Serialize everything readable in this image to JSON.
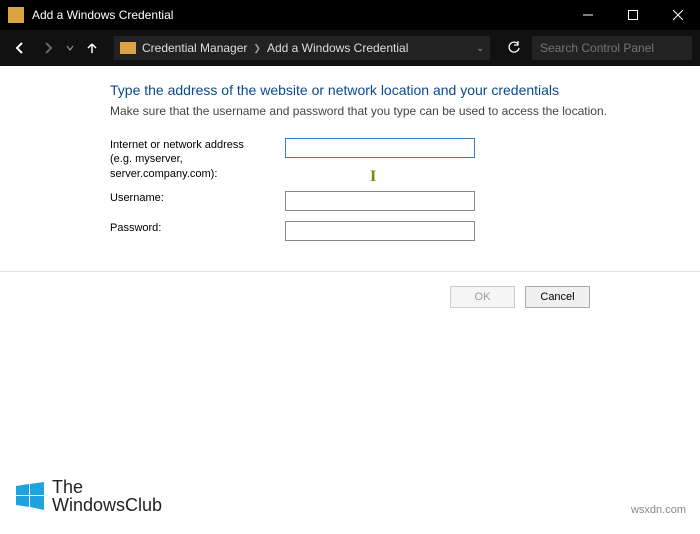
{
  "titlebar": {
    "title": "Add a Windows Credential"
  },
  "nav": {
    "breadcrumb1": "Credential Manager",
    "breadcrumb2": "Add a Windows Credential",
    "search_placeholder": "Search Control Panel"
  },
  "form": {
    "heading": "Type the address of the website or network location and your credentials",
    "subtext": "Make sure that the username and password that you type can be used to access the location.",
    "label_address": "Internet or network address",
    "label_address_hint": "(e.g. myserver, server.company.com):",
    "label_username": "Username:",
    "label_password": "Password:",
    "value_address": "",
    "value_username": "",
    "value_password": ""
  },
  "buttons": {
    "ok": "OK",
    "cancel": "Cancel"
  },
  "brand": {
    "line1": "The",
    "line2": "WindowsClub"
  },
  "watermark": "wsxdn.com"
}
